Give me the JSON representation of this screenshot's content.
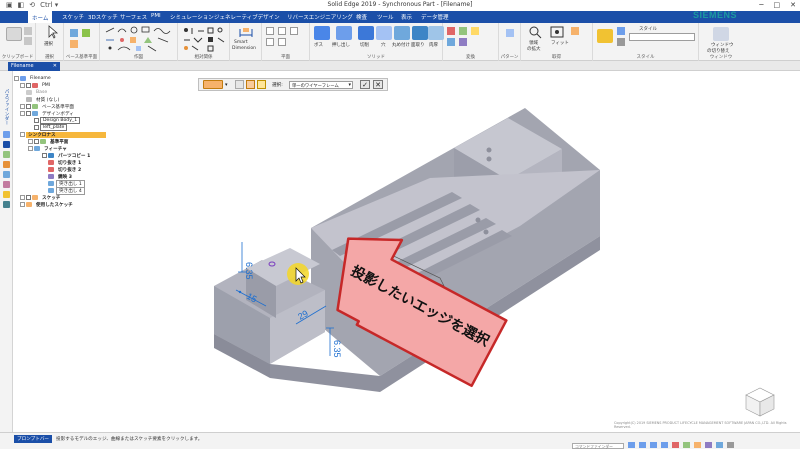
{
  "window": {
    "title": "Solid Edge 2019 - Synchronous Part - [Filename]",
    "controls": [
      "─",
      "□",
      "✕"
    ]
  },
  "quick_access": [
    "▣",
    "◧",
    "⟲",
    "Ctrl ▾"
  ],
  "ribbon": {
    "tabs": [
      "ホーム",
      "スケッチ",
      "3Dスケッチ",
      "サーフェス",
      "PMI",
      "シミュレーション",
      "ジェネレーティブデザイン",
      "リバースエンジニアリング",
      "検査",
      "ツール",
      "表示",
      "データ管理"
    ],
    "active_tab": "ホーム",
    "brand": "SIEMENS",
    "groups": [
      "クリップボード",
      "選択",
      "ベース基準平面",
      "作図",
      "相対関係",
      "平面",
      "ソリッド",
      "変換",
      "パターン",
      "取得",
      "スタイル",
      "ウィンドウ"
    ],
    "buttons": {
      "select": "選択",
      "smart_dimension": [
        "Smart",
        "Dimension"
      ],
      "boss": "ボス",
      "extrude": "押し出し",
      "cutout": "切削",
      "hole": "穴",
      "round": "丸め付け",
      "chamfer": "面取り",
      "thin_wall": "肉厚",
      "move_face": "面の移動",
      "scale": "縮尺",
      "area_zoom": [
        "領域",
        "の拡大"
      ],
      "fit": "フィット",
      "style": "スタイル",
      "switch_window": [
        "ウィンドウ",
        "の切り替え"
      ]
    },
    "style_value": ""
  },
  "document": {
    "tab": "Filename"
  },
  "sidebar": {
    "label": "パスファインダー"
  },
  "tree": [
    {
      "label": "Filename",
      "indent": 0,
      "style": ""
    },
    {
      "label": "PMI",
      "indent": 1,
      "style": ""
    },
    {
      "label": "Base",
      "indent": 1,
      "style": "dim"
    },
    {
      "label": "材質 (なし)",
      "indent": 1,
      "style": ""
    },
    {
      "label": "ベース基準平面",
      "indent": 1,
      "style": ""
    },
    {
      "label": "デザインボディ",
      "indent": 1,
      "style": ""
    },
    {
      "label": "Design Body_1",
      "indent": 2,
      "style": ""
    },
    {
      "label": "left_plate",
      "indent": 2,
      "style": ""
    },
    {
      "label": "シンクロナス",
      "indent": 1,
      "style": "hl bold"
    },
    {
      "label": "基準平面",
      "indent": 2,
      "style": "bold"
    },
    {
      "label": "フィーチャ",
      "indent": 2,
      "style": "bold"
    },
    {
      "label": "パーツコピー 1",
      "indent": 3,
      "style": "bold"
    },
    {
      "label": "切り抜き 1",
      "indent": 3,
      "style": "bold"
    },
    {
      "label": "切り抜き 2",
      "indent": 3,
      "style": "bold"
    },
    {
      "label": "鏡映 3",
      "indent": 3,
      "style": "bold"
    },
    {
      "label": "突き出し 1",
      "indent": 3,
      "style": ""
    },
    {
      "label": "突き出し 4",
      "indent": 3,
      "style": ""
    },
    {
      "label": "スケッチ",
      "indent": 1,
      "style": "bold"
    },
    {
      "label": "使用したスケッチ",
      "indent": 1,
      "style": "bold"
    }
  ],
  "select_toolbar": {
    "label": "選択:",
    "dropdown_value": "単一のワイヤーフレーム"
  },
  "dimensions": {
    "vertical_top": "6.35",
    "front": "15",
    "edge": "29",
    "vertical_bottom": "6.35"
  },
  "callout": {
    "text": "投影したいエッジを選択",
    "fill": "#f4a7a7",
    "stroke": "#c62828"
  },
  "status": {
    "prompt_tab": "プロンプトバー",
    "message": "投影するモデルのエッジ、曲線またはスケッチ要素をクリックします。",
    "find_placeholder": "コマンドファインダー"
  },
  "copyright": "Copyright(C) 2019 SIEMENS PRODUCT LIFECYCLE MANAGEMENT SOFTWARE JAPAN CO.,LTD. All Rights Reserved.",
  "colors": {
    "accent": "#1b4fa8",
    "brand": "#1b9aa0",
    "model_top": "#c3c3cd",
    "model_front": "#9da0ac",
    "model_side": "#b2b3be",
    "dimension": "#1e6fd0",
    "cursor_highlight": "#f5d726"
  }
}
